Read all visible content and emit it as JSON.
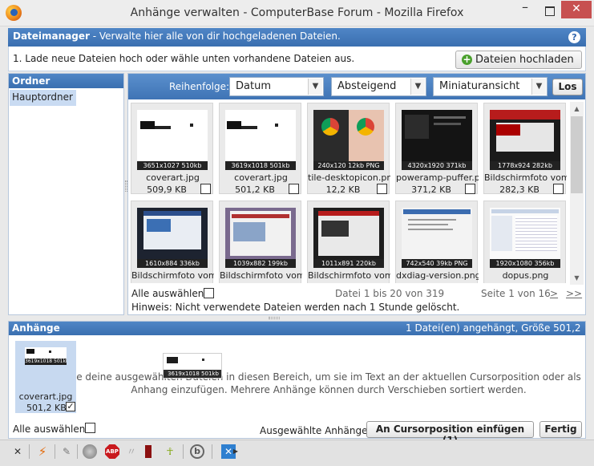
{
  "window": {
    "title": "Anhänge verwalten - ComputerBase Forum - Mozilla Firefox",
    "minimize": "–",
    "close": "✕"
  },
  "header": {
    "title": "Dateimanager",
    "subtitle": " - Verwalte hier alle von dir hochgeladenen Dateien.",
    "help": "?"
  },
  "instruction": "1. Lade neue Dateien hoch oder wähle unten vorhandene Dateien aus.",
  "upload_button": "Dateien hochladen",
  "folders": {
    "title": "Ordner",
    "items": [
      "Hauptordner"
    ]
  },
  "sort": {
    "label": "Reihenfolge:",
    "field": "Datum",
    "direction": "Absteigend",
    "view": "Miniaturansicht",
    "go": "Los"
  },
  "files": [
    {
      "name": "coverart.jpg",
      "size": "509,9 KB",
      "dim": "3651x1027 510kb"
    },
    {
      "name": "coverart.jpg",
      "size": "501,2 KB",
      "dim": "3619x1018 501kb"
    },
    {
      "name": "tile-desktopicon.pn",
      "size": "12,2 KB",
      "dim": "240x120 12kb PNG"
    },
    {
      "name": "poweramp-puffer.p",
      "size": "371,2 KB",
      "dim": "4320x1920 371kb"
    },
    {
      "name": "Bildschirmfoto vom",
      "size": "282,3 KB",
      "dim": "1778x924 282kb"
    },
    {
      "name": "Bildschirmfoto vom",
      "size": "",
      "dim": "1610x884 336kb"
    },
    {
      "name": "Bildschirmfoto vom",
      "size": "",
      "dim": "1039x882 199kb"
    },
    {
      "name": "Bildschirmfoto vom",
      "size": "",
      "dim": "1011x891 220kb"
    },
    {
      "name": "dxdiag-version.png",
      "size": "",
      "dim": "742x540 39kb PNG"
    },
    {
      "name": "dopus.png",
      "size": "",
      "dim": "1920x1080 356kb"
    }
  ],
  "footer": {
    "select_all": "Alle auswählen",
    "range": "Datei 1 bis 20 von 319",
    "page": "Seite 1 von 16",
    "next": ">",
    "last": ">>",
    "hint": "Hinweis: Nicht verwendete Dateien werden nach 1 Stunde gelöscht."
  },
  "attachments": {
    "title": "Anhänge",
    "info": "1 Datei(en) angehängt, Größe 501,2 KB",
    "item": {
      "name": "coverart.jpg",
      "size": "501,2 KB",
      "dim": "3619x1018 501kb",
      "check": "✓"
    },
    "hint_line1": "e deine ausgewählten Dateien in diesen Bereich, um sie im Text an der aktuellen Cursorposition oder als",
    "hint_line2": "Anhang einzufügen. Mehrere Anhänge können durch Verschieben sortiert werden.",
    "select_all": "Alle auswählen",
    "selected_label": "Ausgewählte Anhänge:",
    "insert_button": "An Cursorposition einfügen (1)",
    "done_button": "Fertig"
  },
  "addon_bar": {
    "close": "✕",
    "abp": "ABP"
  }
}
